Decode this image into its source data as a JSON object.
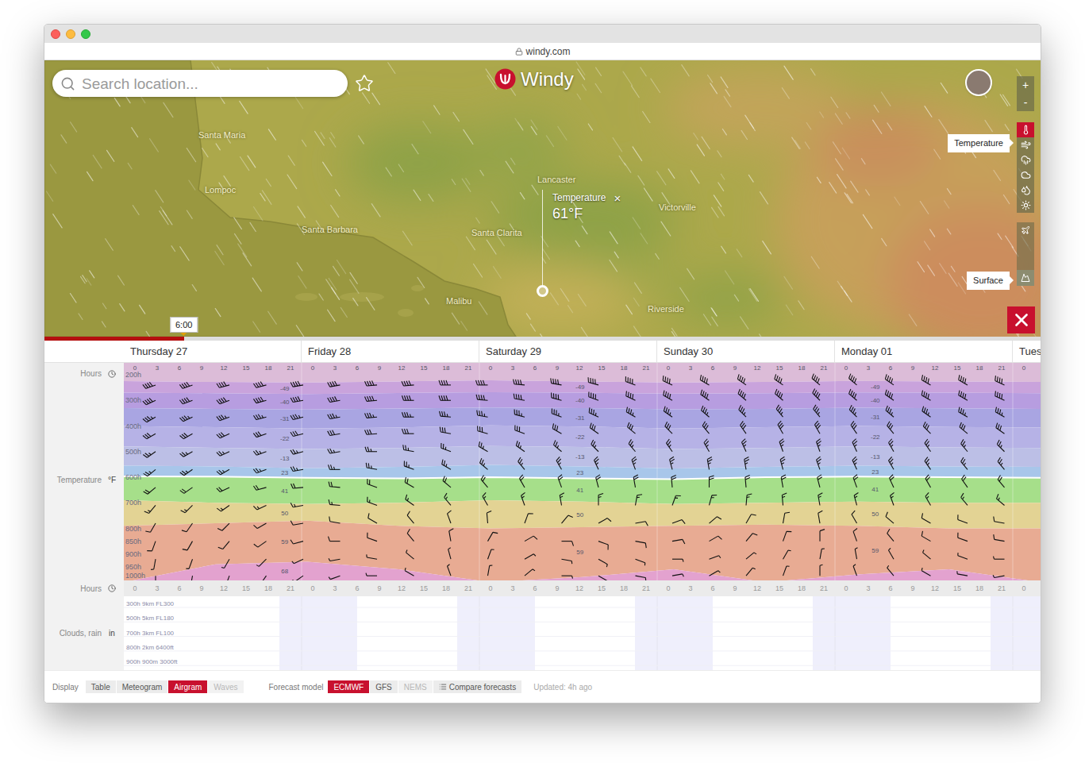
{
  "browser": {
    "url": "windy.com"
  },
  "map": {
    "search": {
      "placeholder": "Search location..."
    },
    "logo": "Windy",
    "zoom": [
      "+",
      "-"
    ],
    "layers": [
      {
        "selected": true
      },
      {
        "selected": false
      },
      {
        "selected": false
      },
      {
        "selected": false
      },
      {
        "selected": false
      },
      {
        "selected": false
      }
    ],
    "layer_label": "Temperature",
    "altitudes": [
      {
        "selected": false
      },
      {
        "selected": true
      }
    ],
    "altitude_label": "Surface",
    "popup": {
      "title": "Temperature",
      "value": "61°F",
      "close": "×"
    },
    "cities": [
      "Santa Maria",
      "Lompoc",
      "Santa Barbara",
      "Santa Clarita",
      "Lancaster",
      "Victorville",
      "Malibu",
      "Riverside"
    ]
  },
  "timeline": {
    "time": "6:00",
    "level": 0.14
  },
  "days": [
    {
      "label": "Thursday 27"
    },
    {
      "label": "Friday 28"
    },
    {
      "label": "Saturday 29"
    },
    {
      "label": "Sunday 30"
    },
    {
      "label": "Monday 01"
    },
    {
      "label": "Tues"
    }
  ],
  "airgram": {
    "hours_label": "Hours",
    "temperature_label": "Temperature",
    "unit": "°F",
    "hours": [
      "0",
      "3",
      "6",
      "9",
      "12",
      "15",
      "18",
      "21"
    ],
    "levels": [
      {
        "label": "200h",
        "hpa": 200
      },
      {
        "label": "300h",
        "hpa": 300
      },
      {
        "label": "400h",
        "hpa": 400
      },
      {
        "label": "500h",
        "hpa": 500
      },
      {
        "label": "600h",
        "hpa": 600
      },
      {
        "label": "700h",
        "hpa": 700
      },
      {
        "label": "800h",
        "hpa": 800
      },
      {
        "label": "850h",
        "hpa": 850
      },
      {
        "label": "900h",
        "hpa": 900
      },
      {
        "label": "950h",
        "hpa": 950
      },
      {
        "label": "1000h",
        "hpa": 1000
      }
    ],
    "bands": [
      {
        "color": "#dcbcd8",
        "bottom": [
          225,
          228,
          230,
          226,
          222,
          226,
          230,
          228,
          224,
          226,
          228
        ]
      },
      {
        "color": "#c9a3dc",
        "label": "-49",
        "bottom": [
          270,
          272,
          275,
          271,
          268,
          270,
          274,
          272,
          269,
          270,
          272
        ]
      },
      {
        "color": "#b79de0",
        "label": "-40",
        "bottom": [
          330,
          333,
          336,
          332,
          328,
          330,
          335,
          333,
          329,
          331,
          333
        ]
      },
      {
        "color": "#a9a5e2",
        "label": "-31",
        "bottom": [
          400,
          405,
          410,
          406,
          398,
          402,
          410,
          405,
          400,
          404,
          406
        ]
      },
      {
        "color": "#b6b2e6",
        "label": "-22",
        "bottom": [
          480,
          485,
          490,
          486,
          478,
          482,
          490,
          486,
          480,
          484,
          486
        ]
      },
      {
        "color": "#bcbfe6",
        "label": "-13",
        "bottom": [
          555,
          558,
          565,
          560,
          552,
          558,
          566,
          560,
          555,
          558,
          560
        ]
      },
      {
        "color": "#a8c6ea",
        "label": "23",
        "bottom": [
          597,
          598,
          602,
          605,
          600,
          605,
          608,
          600,
          598,
          600,
          602
        ]
      },
      {
        "color": "#a6df8a",
        "label": "41",
        "bottom": [
          690,
          700,
          705,
          700,
          690,
          695,
          705,
          700,
          695,
          700,
          700
        ]
      },
      {
        "color": "#e3d394",
        "label": "50",
        "bottom": [
          790,
          780,
          770,
          790,
          800,
          795,
          790,
          785,
          790,
          800,
          800
        ]
      },
      {
        "color": "#e8ab93",
        "label": "59",
        "bottom": [
          1010,
          940,
          930,
          960,
          1010,
          990,
          960,
          1010,
          980,
          960,
          1010
        ]
      },
      {
        "color": "#e3a2cf",
        "label": "68",
        "bottom": [
          1050,
          1050,
          1050,
          1050,
          1050,
          1050,
          1050,
          1050,
          1050,
          1050,
          1050
        ]
      }
    ],
    "freezing_level": [
      597,
      598,
      602,
      605,
      600,
      605,
      608,
      600,
      598,
      600,
      602
    ],
    "barbs": [
      {
        "hpa": 240,
        "kt": 40,
        "dir": [
          250,
          250,
          255,
          255,
          260,
          260,
          265,
          265,
          270,
          270,
          275,
          280,
          285,
          290,
          295,
          300,
          305,
          305,
          310,
          310,
          305,
          300,
          300,
          295
        ]
      },
      {
        "hpa": 300,
        "kt": 40,
        "dir": [
          245,
          250,
          250,
          255,
          260,
          260,
          265,
          270,
          270,
          275,
          280,
          285,
          290,
          295,
          300,
          305,
          310,
          310,
          315,
          310,
          305,
          300,
          300,
          295
        ]
      },
      {
        "hpa": 365,
        "kt": 35,
        "dir": [
          240,
          245,
          250,
          255,
          255,
          260,
          265,
          270,
          275,
          280,
          285,
          290,
          295,
          300,
          305,
          310,
          315,
          320,
          320,
          315,
          310,
          305,
          300,
          300
        ]
      },
      {
        "hpa": 430,
        "kt": 30,
        "dir": [
          240,
          240,
          245,
          250,
          255,
          260,
          265,
          270,
          280,
          285,
          290,
          300,
          305,
          310,
          315,
          320,
          325,
          330,
          330,
          325,
          320,
          315,
          310,
          305
        ]
      },
      {
        "hpa": 500,
        "kt": 25,
        "dir": [
          235,
          240,
          245,
          250,
          255,
          260,
          270,
          280,
          290,
          300,
          305,
          310,
          315,
          320,
          325,
          330,
          335,
          340,
          340,
          335,
          330,
          325,
          320,
          315
        ]
      },
      {
        "hpa": 570,
        "kt": 25,
        "dir": [
          230,
          235,
          240,
          250,
          260,
          270,
          280,
          290,
          300,
          310,
          320,
          330,
          335,
          340,
          345,
          350,
          350,
          345,
          340,
          335,
          330,
          325,
          320,
          320
        ]
      },
      {
        "hpa": 640,
        "kt": 20,
        "dir": [
          230,
          235,
          245,
          255,
          265,
          275,
          290,
          300,
          310,
          320,
          330,
          340,
          345,
          350,
          355,
          0,
          355,
          350,
          345,
          340,
          335,
          330,
          325,
          320
        ]
      },
      {
        "hpa": 710,
        "kt": 15,
        "dir": [
          220,
          225,
          235,
          245,
          260,
          275,
          290,
          305,
          320,
          330,
          340,
          350,
          0,
          10,
          20,
          15,
          5,
          355,
          350,
          345,
          340,
          330,
          320,
          310
        ]
      },
      {
        "hpa": 780,
        "kt": 10,
        "dir": [
          210,
          215,
          225,
          240,
          260,
          280,
          300,
          320,
          340,
          355,
          20,
          40,
          60,
          80,
          70,
          50,
          30,
          10,
          350,
          330,
          310,
          300,
          290,
          280
        ]
      },
      {
        "hpa": 850,
        "kt": 10,
        "dir": [
          200,
          210,
          220,
          235,
          255,
          270,
          290,
          320,
          350,
          30,
          60,
          90,
          110,
          100,
          80,
          60,
          40,
          20,
          0,
          340,
          320,
          300,
          290,
          280
        ]
      },
      {
        "hpa": 920,
        "kt": 5,
        "dir": [
          190,
          200,
          210,
          225,
          245,
          260,
          280,
          310,
          345,
          20,
          60,
          100,
          120,
          110,
          90,
          70,
          50,
          30,
          10,
          350,
          330,
          310,
          290,
          270
        ]
      },
      {
        "hpa": 985,
        "kt": 5,
        "dir": [
          180,
          190,
          200,
          215,
          235,
          250,
          270,
          300,
          340,
          10,
          50,
          90,
          120,
          100,
          80,
          60,
          40,
          20,
          0,
          340,
          320,
          300,
          280,
          260
        ]
      }
    ]
  },
  "clouds": {
    "hours_label": "Hours",
    "label": "Clouds, rain",
    "unit": "in",
    "levels": [
      "300h 9km FL300",
      "500h 5km FL180",
      "700h 3km FL100",
      "800h 2km 6400ft",
      "900h 900m 3000ft"
    ]
  },
  "footer": {
    "display_label": "Display",
    "display_options": [
      {
        "label": "Table",
        "selected": false,
        "disabled": false
      },
      {
        "label": "Meteogram",
        "selected": false,
        "disabled": false
      },
      {
        "label": "Airgram",
        "selected": true,
        "disabled": false
      },
      {
        "label": "Waves",
        "selected": false,
        "disabled": true
      }
    ],
    "model_label": "Forecast model",
    "models": [
      {
        "label": "ECMWF",
        "selected": true,
        "disabled": false
      },
      {
        "label": "GFS",
        "selected": false,
        "disabled": false
      },
      {
        "label": "NEMS",
        "selected": false,
        "disabled": true
      }
    ],
    "compare": "Compare forecasts",
    "updated": "Updated: 4h ago"
  }
}
